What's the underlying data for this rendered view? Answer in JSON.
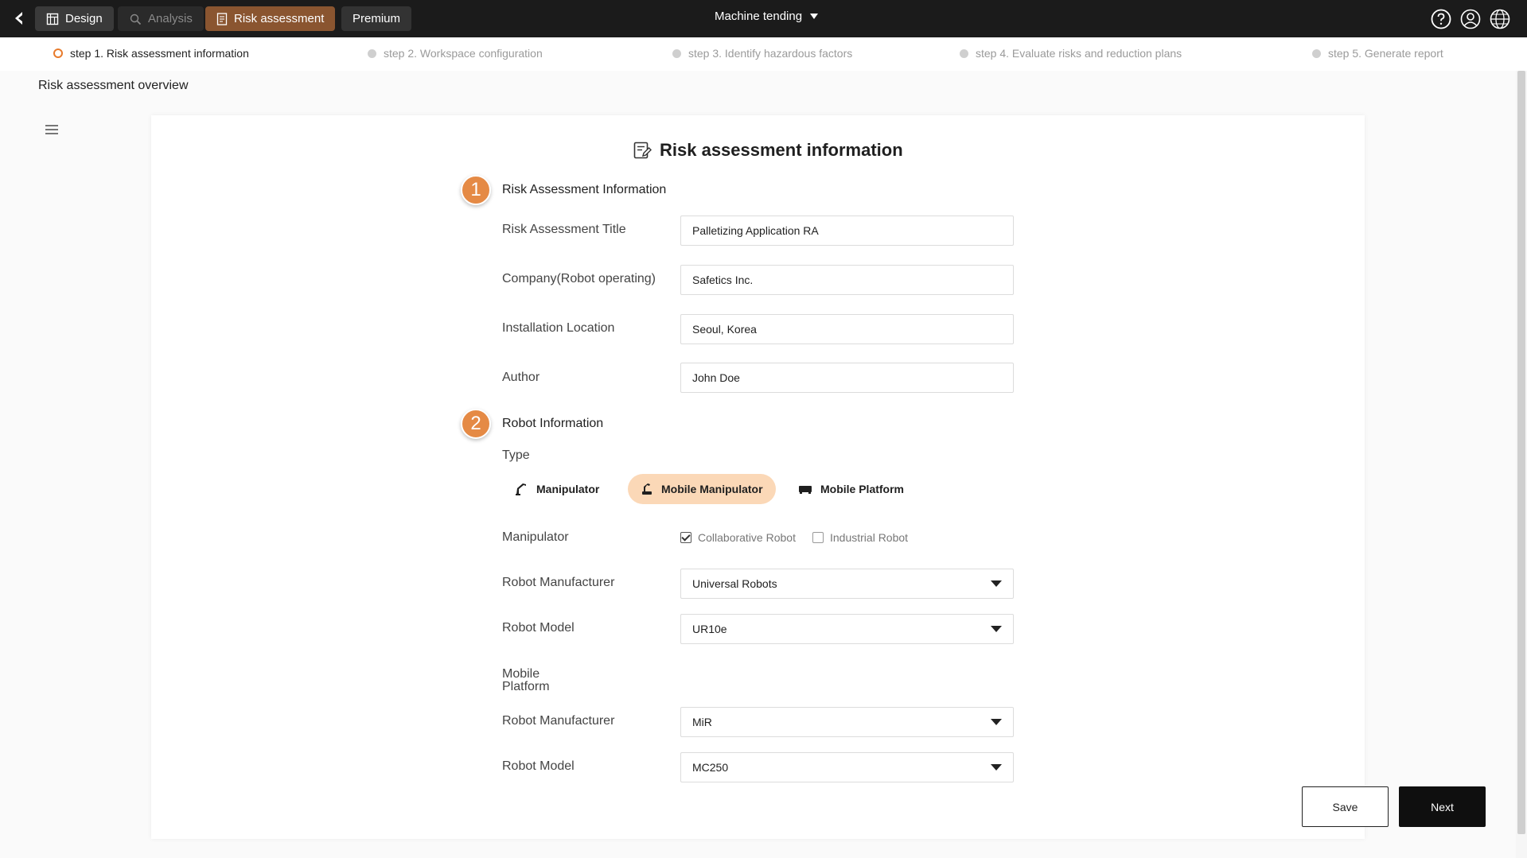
{
  "header": {
    "tabs": [
      {
        "label": "Design",
        "icon": "design-grid-icon"
      },
      {
        "label": "Analysis",
        "icon": "analysis-icon"
      },
      {
        "label": "Risk assessment",
        "icon": "document-icon"
      },
      {
        "label": "Premium"
      }
    ],
    "project_title": "Machine tending",
    "accent_color": "#8a5530"
  },
  "stepper": {
    "steps": [
      {
        "label": "step 1. Risk assessment information",
        "active": true
      },
      {
        "label": "step 2. Workspace configuration",
        "active": false
      },
      {
        "label": "step 3. Identify hazardous factors",
        "active": false
      },
      {
        "label": "step 4. Evaluate risks and reduction plans",
        "active": false
      },
      {
        "label": "step 5. Generate report",
        "active": false
      }
    ],
    "active_color": "#e87b2c"
  },
  "overview_title": "Risk assessment overview",
  "card": {
    "title": "Risk assessment information",
    "section1": {
      "number": "1",
      "title": "Risk Assessment Information",
      "fields": [
        {
          "label": "Risk Assessment Title",
          "value": "Palletizing Application RA"
        },
        {
          "label": "Company(Robot operating)",
          "value": "Safetics Inc."
        },
        {
          "label": "Installation Location",
          "value": "Seoul, Korea"
        },
        {
          "label": "Author",
          "value": "John Doe"
        }
      ]
    },
    "section2": {
      "number": "2",
      "title": "Robot Information",
      "type_label": "Type",
      "types": [
        {
          "label": "Manipulator",
          "icon": "robot-arm-icon",
          "selected": false
        },
        {
          "label": "Mobile Manipulator",
          "icon": "mobile-manipulator-icon",
          "selected": true
        },
        {
          "label": "Mobile Platform",
          "icon": "mobile-platform-icon",
          "selected": false
        }
      ],
      "manipulator_label": "Manipulator",
      "manipulator_options": [
        {
          "label": "Collaborative Robot",
          "checked": true
        },
        {
          "label": "Industrial Robot",
          "checked": false
        }
      ],
      "manipulator_manufacturer_label": "Robot Manufacturer",
      "manipulator_manufacturer": "Universal Robots",
      "manipulator_model_label": "Robot Model",
      "manipulator_model": "UR10e",
      "mobile_platform_label": "Mobile Platform",
      "platform_manufacturer_label": "Robot Manufacturer",
      "platform_manufacturer": "MiR",
      "platform_model_label": "Robot Model",
      "platform_model": "MC250"
    },
    "badge_color": "#e58a45",
    "selected_type_color": "#fbd8b7"
  },
  "buttons": {
    "save": "Save",
    "next": "Next"
  }
}
